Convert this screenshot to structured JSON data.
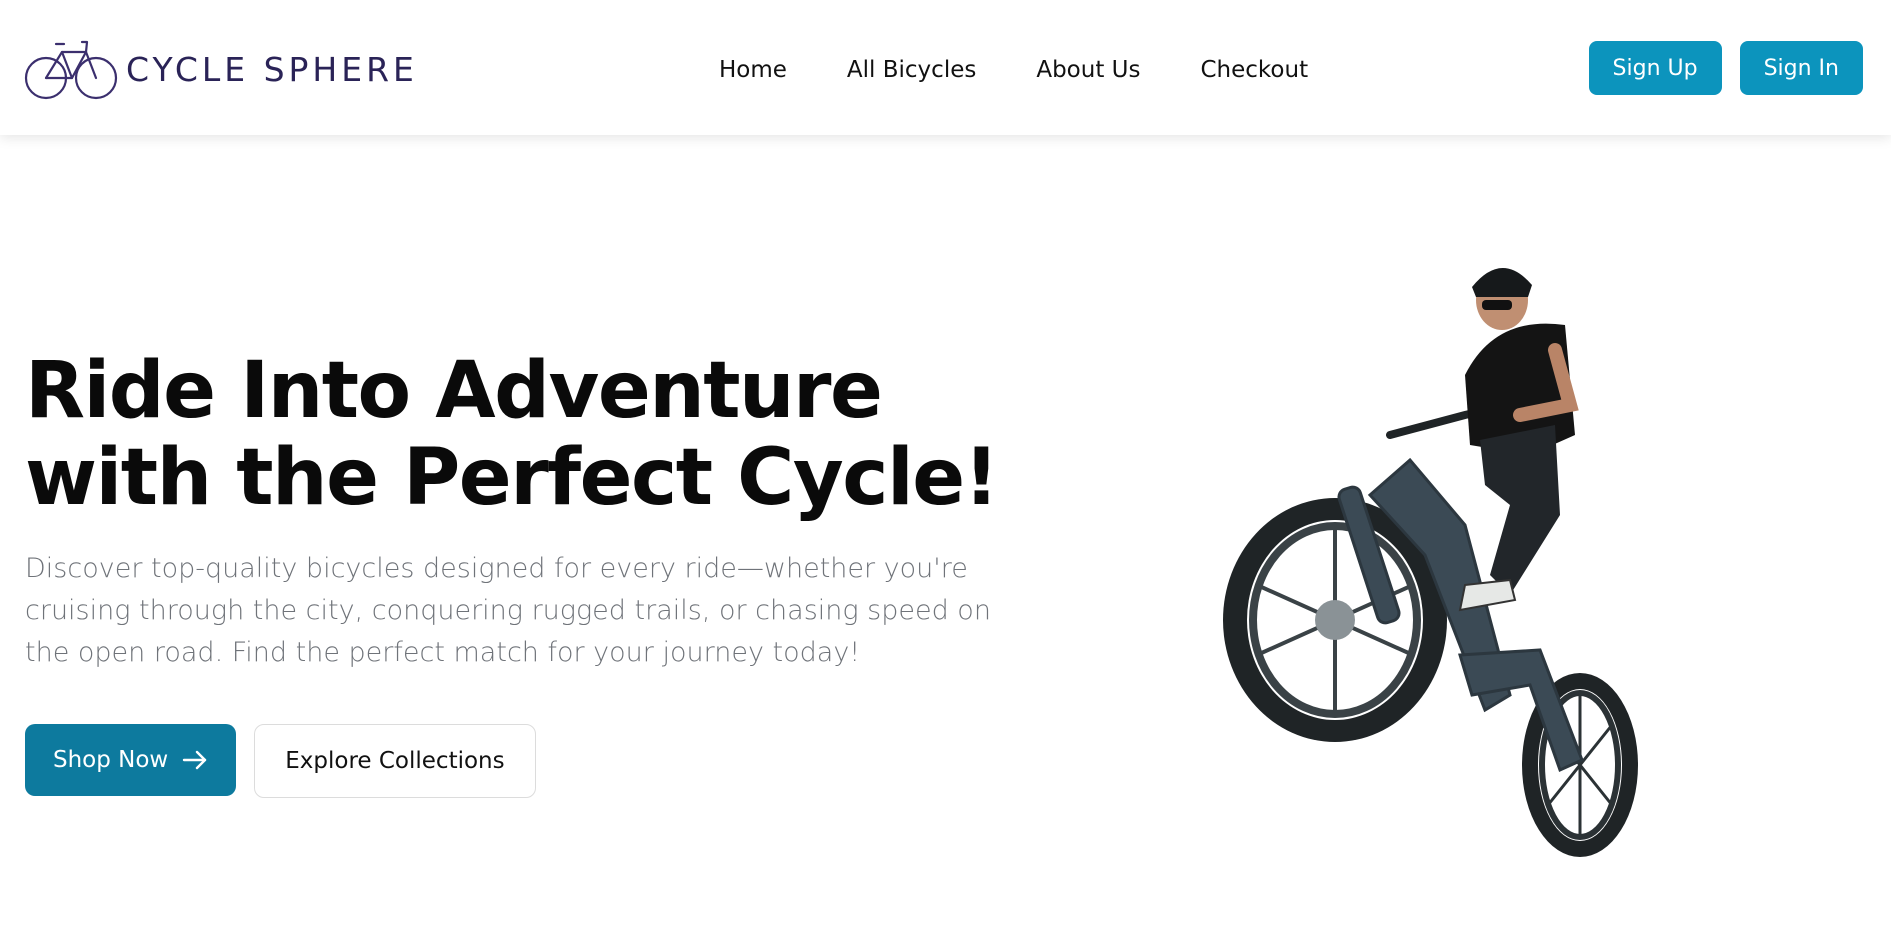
{
  "brand": {
    "name": "CYCLE SPHERE",
    "logo_icon": "bicycle-icon",
    "text_color": "#2a2357"
  },
  "nav": {
    "items": [
      {
        "label": "Home"
      },
      {
        "label": "All Bicycles"
      },
      {
        "label": "About Us"
      },
      {
        "label": "Checkout"
      }
    ]
  },
  "auth": {
    "sign_up": "Sign Up",
    "sign_in": "Sign In",
    "color": "#0c94bd"
  },
  "hero": {
    "title_line1": "Ride Into Adventure",
    "title_line2": "with the Perfect Cycle!",
    "subtitle": "Discover top-quality bicycles designed for every ride—whether you're cruising through the city, conquering rugged trails, or chasing speed on the open road. Find the perfect match for your journey today!",
    "primary_button": "Shop Now",
    "primary_icon": "arrow-right-icon",
    "primary_color": "#0d7a9e",
    "secondary_button": "Explore Collections",
    "image_icon": "rider-on-fat-tire-ebike-photo"
  }
}
